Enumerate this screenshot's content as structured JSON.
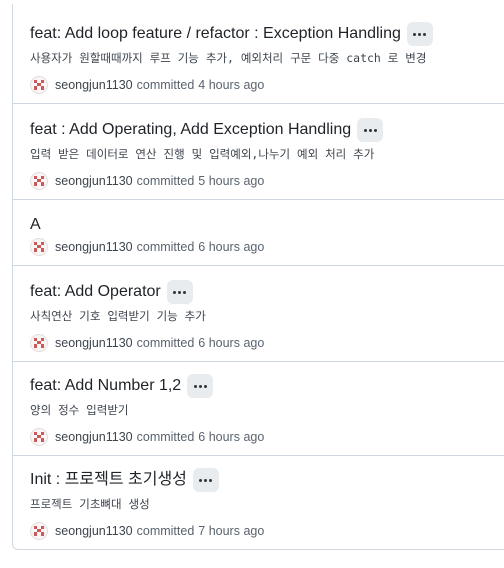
{
  "colors": {
    "border": "#d0d7de",
    "title_text": "#1f2328",
    "muted_text": "#59636e",
    "ellipsis_bg": "#e9ecef",
    "avatar_accent": "#c85a5a"
  },
  "icons": {
    "avatar": "identicon-avatar-icon",
    "ellipsis": "ellipsis-icon"
  },
  "commits": [
    {
      "title": "feat: Add loop feature / refactor : Exception Handling",
      "description": "사용자가 원할때때까지 루프 기능 추가, 예외처리 구문 다중 catch 로 변경",
      "author": "seongjun1130",
      "action": "committed",
      "time": "4 hours ago"
    },
    {
      "title": "feat : Add Operating, Add Exception Handling",
      "description": "입력 받은 데이터로 연산 진행 및 입력예외,나누기 예외 처리 추가",
      "author": "seongjun1130",
      "action": "committed",
      "time": "5 hours ago"
    },
    {
      "title": "A",
      "author": "seongjun1130",
      "action": "committed",
      "time": "6 hours ago"
    },
    {
      "title": "feat: Add Operator",
      "description": "사칙연산 기호 입력받기 기능 추가",
      "author": "seongjun1130",
      "action": "committed",
      "time": "6 hours ago"
    },
    {
      "title": "feat: Add Number 1,2",
      "description": "양의 정수 입력받기",
      "author": "seongjun1130",
      "action": "committed",
      "time": "6 hours ago"
    },
    {
      "title": "Init : 프로젝트 초기생성",
      "description": "프로젝트 기초뼈대 생성",
      "author": "seongjun1130",
      "action": "committed",
      "time": "7 hours ago"
    }
  ]
}
